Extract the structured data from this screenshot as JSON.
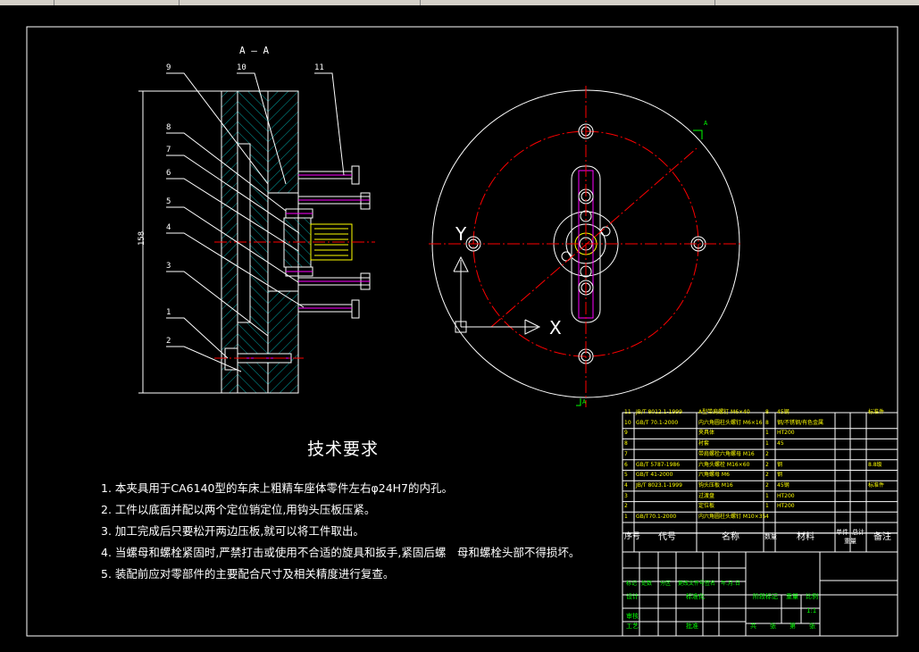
{
  "section_label": "A — A",
  "dim_vertical": "158",
  "part_callouts": [
    "9",
    "10",
    "11",
    "8",
    "7",
    "6",
    "5",
    "4",
    "3",
    "1",
    "2"
  ],
  "view_axis": {
    "y": "Y",
    "x": "X",
    "a": "A"
  },
  "tech_req": {
    "title": "技术要求",
    "lines": [
      "1. 本夹具用于CA6140型的车床上粗精车座体零件左右φ24H7的内孔。",
      "2. 工件以底面并配以两个定位销定位,用钩头压板压紧。",
      "3. 加工完成后只要松开两边压板,就可以将工件取出。",
      "4. 当螺母和螺栓紧固时,严禁打击或使用不合适的旋具和扳手,紧固后螺　母和螺栓头部不得损坏。",
      "5. 装配前应对零部件的主要配合尺寸及相关精度进行复查。"
    ]
  },
  "bom": [
    {
      "no": "11",
      "code": "JB/T 8012.1-1999",
      "name": "A型带肩螺钉 M6×40",
      "qty": "8",
      "mat": "45钢",
      "note": "标准件"
    },
    {
      "no": "10",
      "code": "GB/T 70.1-2000",
      "name": "内六角圆柱头螺钉 M6×16",
      "qty": "8",
      "mat": "钢/不锈钢/有色金属",
      "note": ""
    },
    {
      "no": "9",
      "code": "",
      "name": "夹具体",
      "qty": "1",
      "mat": "HT200",
      "note": ""
    },
    {
      "no": "8",
      "code": "",
      "name": "衬套",
      "qty": "1",
      "mat": "45",
      "note": ""
    },
    {
      "no": "7",
      "code": "",
      "name": "带肩螺栓六角螺母 M16",
      "qty": "2",
      "mat": "",
      "note": ""
    },
    {
      "no": "6",
      "code": "GB/T 5787-1986",
      "name": "六角头螺栓 M16×60",
      "qty": "2",
      "mat": "钢",
      "note": "8.8级"
    },
    {
      "no": "5",
      "code": "GB/T 41-2000",
      "name": "六角螺母 M6",
      "qty": "2",
      "mat": "钢",
      "note": ""
    },
    {
      "no": "4",
      "code": "JB/T 8023.1-1999",
      "name": "钩头压板 M16",
      "qty": "2",
      "mat": "45钢",
      "note": "标准件"
    },
    {
      "no": "3",
      "code": "",
      "name": "过渡盘",
      "qty": "1",
      "mat": "HT200",
      "note": ""
    },
    {
      "no": "2",
      "code": "",
      "name": "定位板",
      "qty": "1",
      "mat": "HT200",
      "note": ""
    },
    {
      "no": "1",
      "code": "GB/T70.1-2000",
      "name": "内六角圆柱头螺钉 M10×35",
      "qty": "4",
      "mat": "",
      "note": ""
    }
  ],
  "bom_header": {
    "no": "序号",
    "code": "代号",
    "name": "名称",
    "qty": "数量",
    "mat": "材料",
    "unit": "单件",
    "total": "总计",
    "weight": "重量",
    "note": "备注"
  },
  "title_block": {
    "rev_row": [
      "标记",
      "处数",
      "分区",
      "更改文件号",
      "签名",
      "年.月.日"
    ],
    "design": "设计",
    "standard": "标准化",
    "stage": "阶段标记",
    "weight": "重量",
    "scale": "比例",
    "scale_value": "1:1",
    "check": "审核",
    "process": "工艺",
    "approve": "批准",
    "sheets": [
      "共",
      "张",
      "第",
      "张"
    ]
  },
  "colors": {
    "background": "#000000",
    "line": "#ffffff",
    "hatch": "#00ffff",
    "center": "#ff0000",
    "yellow": "#ffff00",
    "magenta": "#ff00ff",
    "green": "#00ff00"
  }
}
